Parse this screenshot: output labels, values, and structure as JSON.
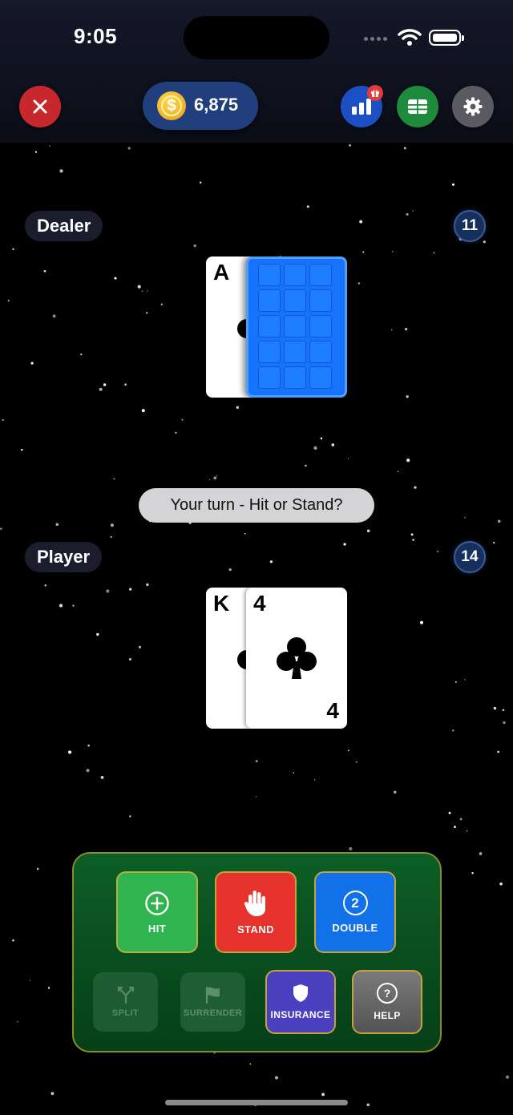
{
  "status_bar": {
    "time": "9:05",
    "icons": [
      "signal-dots-icon",
      "wifi-icon",
      "battery-icon"
    ]
  },
  "header": {
    "close_icon": "close-icon",
    "coins": "6,875",
    "coin_symbol": "$",
    "buttons": [
      "stats-icon",
      "table-icon",
      "gear-icon"
    ],
    "gift_icon": "gift-icon"
  },
  "dealer": {
    "label": "Dealer",
    "score": "11",
    "cards": [
      {
        "rank": "A",
        "suit": "clubs",
        "face_up": true
      },
      {
        "face_up": false
      }
    ]
  },
  "message": "Your turn - Hit or Stand?",
  "player": {
    "label": "Player",
    "score": "14",
    "cards": [
      {
        "rank": "K",
        "suit": "clubs"
      },
      {
        "rank": "4",
        "suit": "clubs"
      }
    ]
  },
  "actions": {
    "hit": "HIT",
    "stand": "STAND",
    "double": "DOUBLE",
    "double_icon_text": "2",
    "split": "SPLIT",
    "surrender": "SURRENDER",
    "insurance": "INSURANCE",
    "help": "HELP",
    "help_icon_text": "?"
  },
  "colors": {
    "background": "#000000",
    "close": "#c8282d",
    "stats": "#1c4fc4",
    "table": "#1e8a3c",
    "settings": "#5a5a60",
    "card_back": "#1773ff",
    "panel": "#0d5e26",
    "hit": "#2fb450",
    "stand": "#e5322d",
    "double": "#1271e8",
    "insurance": "#4a3fbf"
  }
}
